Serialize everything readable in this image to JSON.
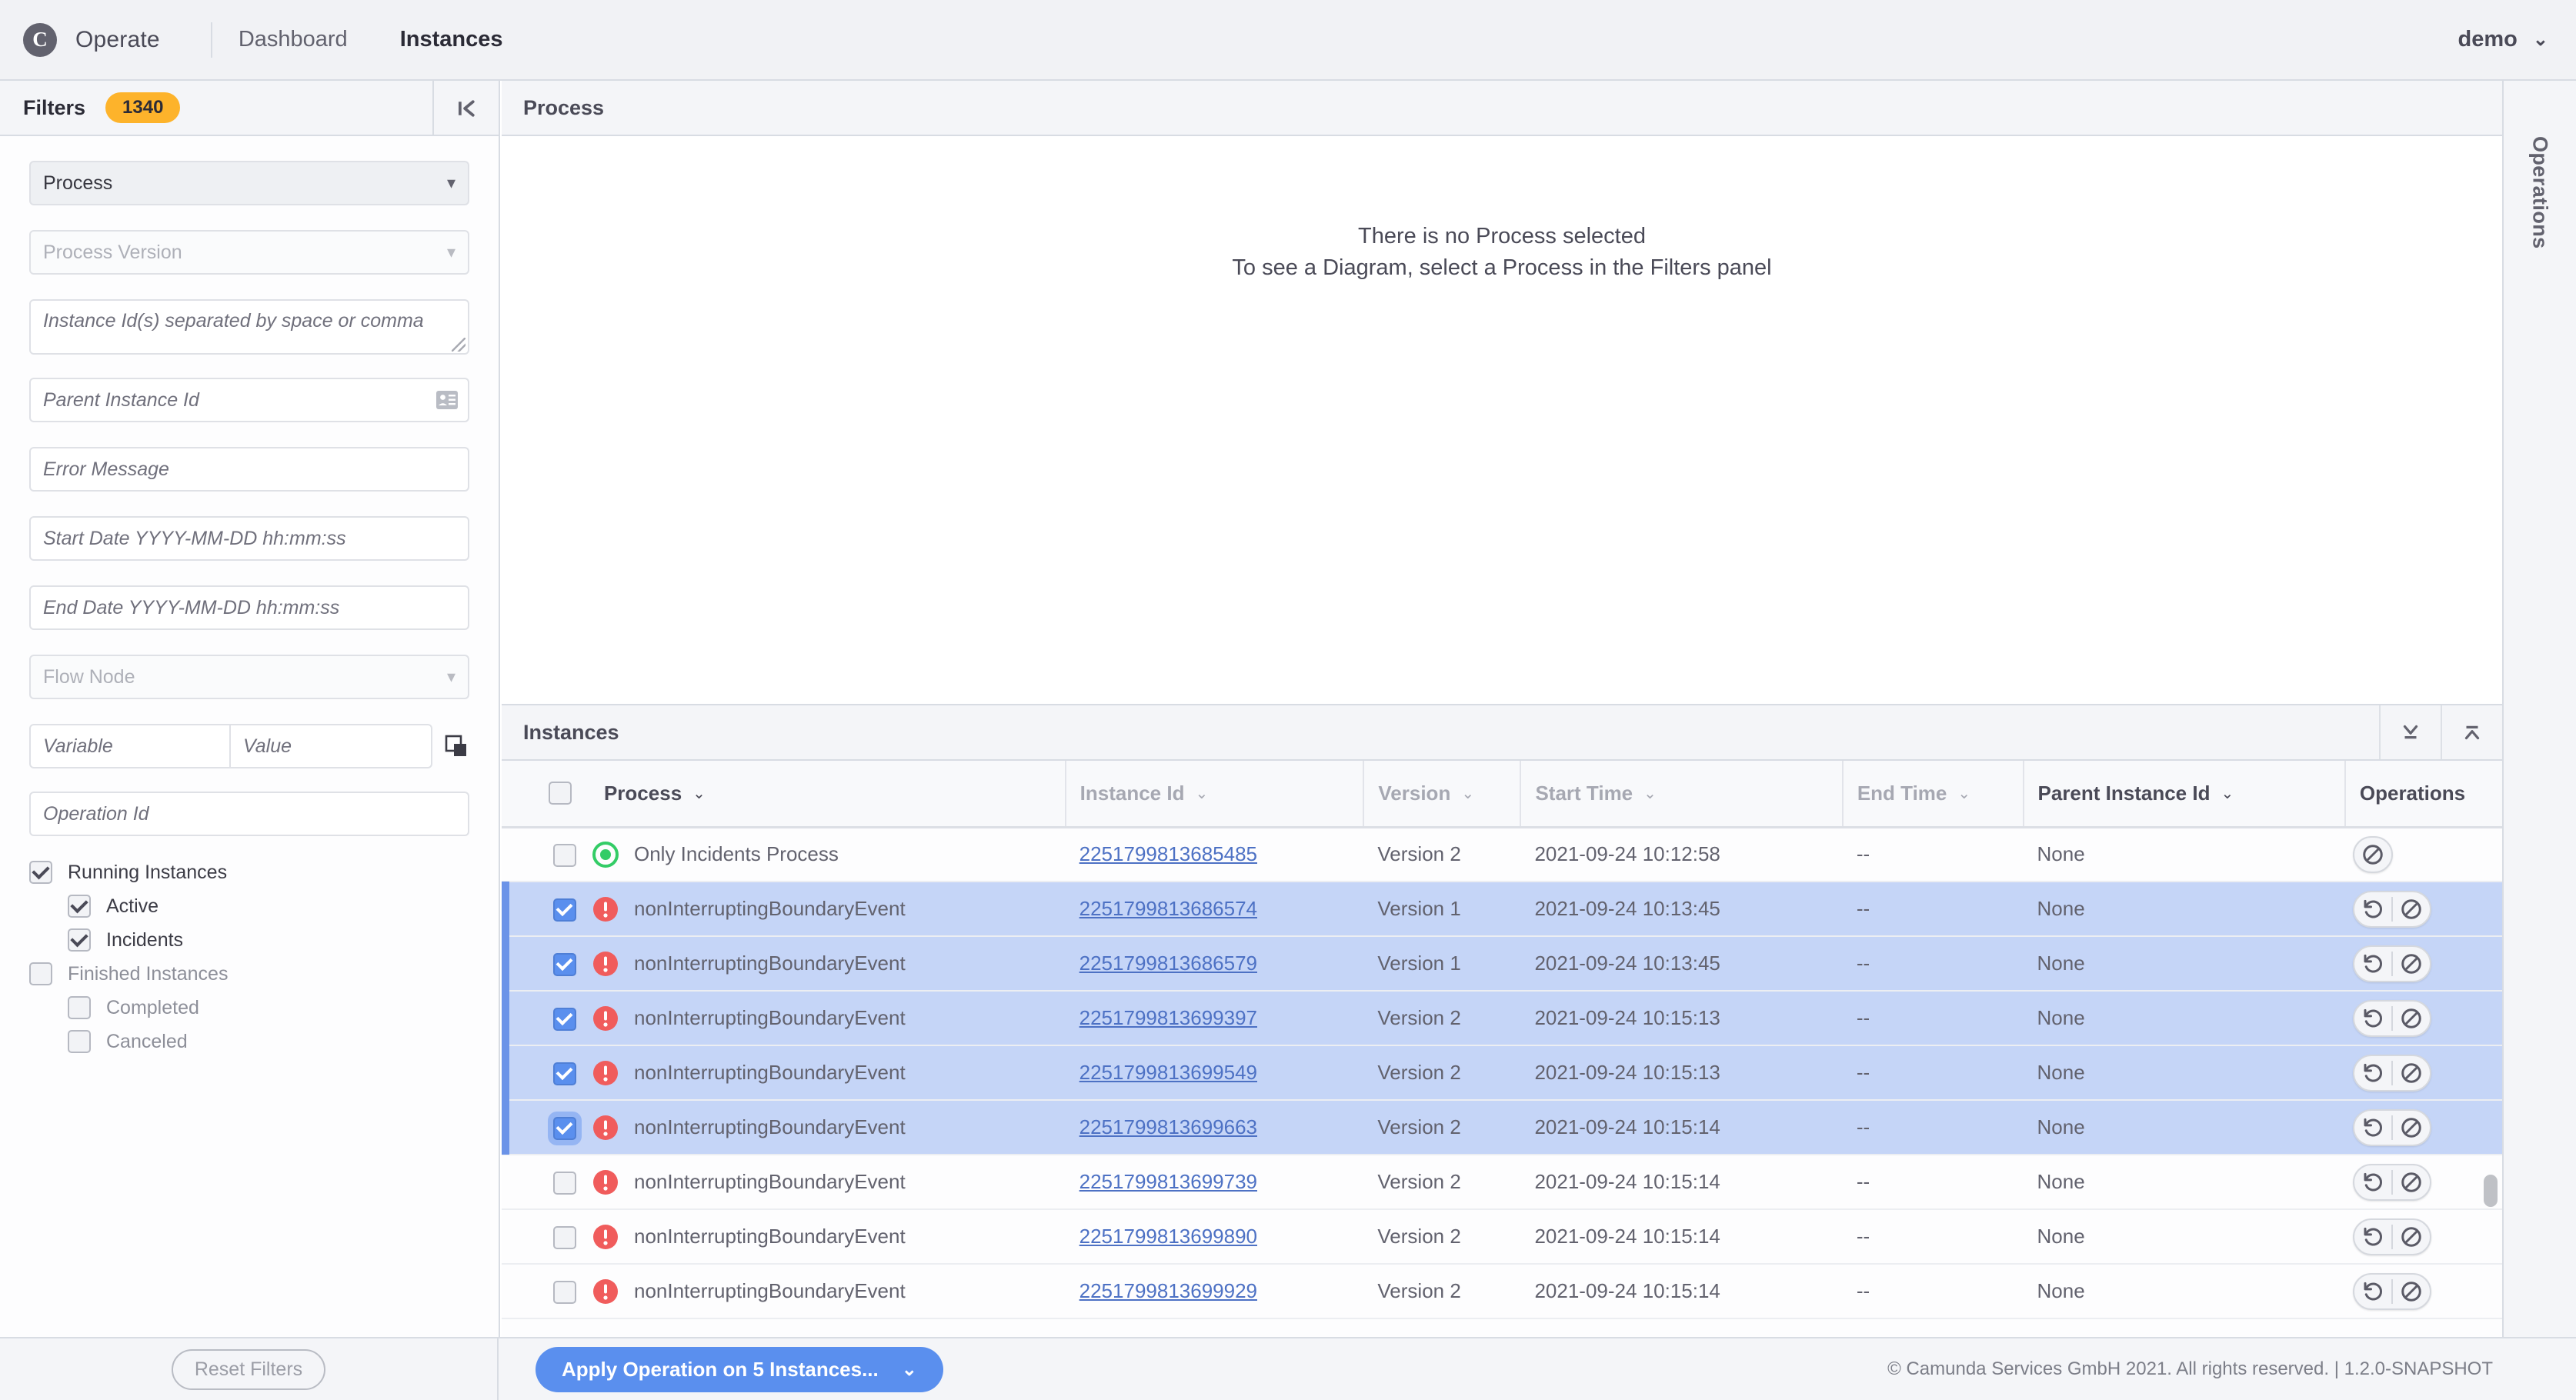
{
  "topbar": {
    "logo_glyph": "C",
    "app_name": "Operate",
    "nav": [
      {
        "label": "Dashboard",
        "active": false
      },
      {
        "label": "Instances",
        "active": true
      }
    ],
    "user": "demo",
    "user_chevron": "⌄"
  },
  "filters": {
    "title": "Filters",
    "count_badge": "1340",
    "collapse_icon": "collapse-left-icon",
    "fields": {
      "process_select": "Process",
      "process_version_select": "Process Version",
      "instance_ids_placeholder": "Instance Id(s) separated by space or comma",
      "parent_instance_id_placeholder": "Parent Instance Id",
      "error_message_placeholder": "Error Message",
      "start_date_placeholder": "Start Date YYYY-MM-DD hh:mm:ss",
      "end_date_placeholder": "End Date YYYY-MM-DD hh:mm:ss",
      "flow_node_select": "Flow Node",
      "variable_placeholder": "Variable",
      "value_placeholder": "Value",
      "operation_id_placeholder": "Operation Id"
    },
    "checkboxes": [
      {
        "label": "Running Instances",
        "checked": true,
        "indent": false,
        "dim": false
      },
      {
        "label": "Active",
        "checked": true,
        "indent": true,
        "dim": false
      },
      {
        "label": "Incidents",
        "checked": true,
        "indent": true,
        "dim": false
      },
      {
        "label": "Finished Instances",
        "checked": false,
        "indent": false,
        "dim": true
      },
      {
        "label": "Completed",
        "checked": false,
        "indent": true,
        "dim": true
      },
      {
        "label": "Canceled",
        "checked": false,
        "indent": true,
        "dim": true
      }
    ]
  },
  "process_pane": {
    "title": "Process",
    "empty_line1": "There is no Process selected",
    "empty_line2": "To see a Diagram, select a Process in the Filters panel"
  },
  "instances_pane": {
    "title": "Instances",
    "expand_down_icon": "collapse-down-icon",
    "expand_up_icon": "collapse-up-icon",
    "columns": [
      {
        "label": "Process",
        "sortable": true,
        "dark": true
      },
      {
        "label": "Instance Id",
        "sortable": true,
        "dark": false
      },
      {
        "label": "Version",
        "sortable": true,
        "dark": false
      },
      {
        "label": "Start Time",
        "sortable": true,
        "dark": false
      },
      {
        "label": "End Time",
        "sortable": true,
        "dark": false
      },
      {
        "label": "Parent Instance Id",
        "sortable": true,
        "dark": true
      },
      {
        "label": "Operations",
        "sortable": false,
        "dark": true
      }
    ],
    "sort_chevron": "⌄",
    "header_checkbox_checked": false,
    "rows": [
      {
        "selected": false,
        "checked": false,
        "state": "active",
        "process": "Only Incidents Process",
        "instance_id": "2251799813685485",
        "version": "Version 2",
        "start_time": "2021-09-24 10:12:58",
        "end_time": "--",
        "parent_instance_id": "None",
        "ops": [
          "cancel"
        ]
      },
      {
        "selected": true,
        "checked": true,
        "state": "incident",
        "process": "nonInterruptingBoundaryEvent",
        "instance_id": "2251799813686574",
        "version": "Version 1",
        "start_time": "2021-09-24 10:13:45",
        "end_time": "--",
        "parent_instance_id": "None",
        "ops": [
          "retry",
          "cancel"
        ]
      },
      {
        "selected": true,
        "checked": true,
        "state": "incident",
        "process": "nonInterruptingBoundaryEvent",
        "instance_id": "2251799813686579",
        "version": "Version 1",
        "start_time": "2021-09-24 10:13:45",
        "end_time": "--",
        "parent_instance_id": "None",
        "ops": [
          "retry",
          "cancel"
        ]
      },
      {
        "selected": true,
        "checked": true,
        "state": "incident",
        "process": "nonInterruptingBoundaryEvent",
        "instance_id": "2251799813699397",
        "version": "Version 2",
        "start_time": "2021-09-24 10:15:13",
        "end_time": "--",
        "parent_instance_id": "None",
        "ops": [
          "retry",
          "cancel"
        ]
      },
      {
        "selected": true,
        "checked": true,
        "state": "incident",
        "process": "nonInterruptingBoundaryEvent",
        "instance_id": "2251799813699549",
        "version": "Version 2",
        "start_time": "2021-09-24 10:15:13",
        "end_time": "--",
        "parent_instance_id": "None",
        "ops": [
          "retry",
          "cancel"
        ]
      },
      {
        "selected": true,
        "checked": true,
        "focused": true,
        "state": "incident",
        "process": "nonInterruptingBoundaryEvent",
        "instance_id": "2251799813699663",
        "version": "Version 2",
        "start_time": "2021-09-24 10:15:14",
        "end_time": "--",
        "parent_instance_id": "None",
        "ops": [
          "retry",
          "cancel"
        ]
      },
      {
        "selected": false,
        "checked": false,
        "state": "incident",
        "process": "nonInterruptingBoundaryEvent",
        "instance_id": "2251799813699739",
        "version": "Version 2",
        "start_time": "2021-09-24 10:15:14",
        "end_time": "--",
        "parent_instance_id": "None",
        "ops": [
          "retry",
          "cancel"
        ]
      },
      {
        "selected": false,
        "checked": false,
        "state": "incident",
        "process": "nonInterruptingBoundaryEvent",
        "instance_id": "2251799813699890",
        "version": "Version 2",
        "start_time": "2021-09-24 10:15:14",
        "end_time": "--",
        "parent_instance_id": "None",
        "ops": [
          "retry",
          "cancel"
        ]
      },
      {
        "selected": false,
        "checked": false,
        "state": "incident",
        "process": "nonInterruptingBoundaryEvent",
        "instance_id": "2251799813699929",
        "version": "Version 2",
        "start_time": "2021-09-24 10:15:14",
        "end_time": "--",
        "parent_instance_id": "None",
        "ops": [
          "retry",
          "cancel"
        ]
      }
    ]
  },
  "operations_rail": {
    "label": "Operations"
  },
  "bottombar": {
    "reset_label": "Reset Filters",
    "apply_label": "Apply Operation on 5 Instances...",
    "apply_chevron": "⌄",
    "copyright": "© Camunda Services GmbH 2021. All rights reserved. | 1.2.0-SNAPSHOT"
  },
  "colors": {
    "accent_blue": "#5a8fee",
    "badge_orange": "#fdb32b",
    "incident_red": "#f05c5c",
    "active_green": "#33cc66",
    "link_blue": "#4d71c4",
    "row_selected": "#c5d5f7"
  }
}
